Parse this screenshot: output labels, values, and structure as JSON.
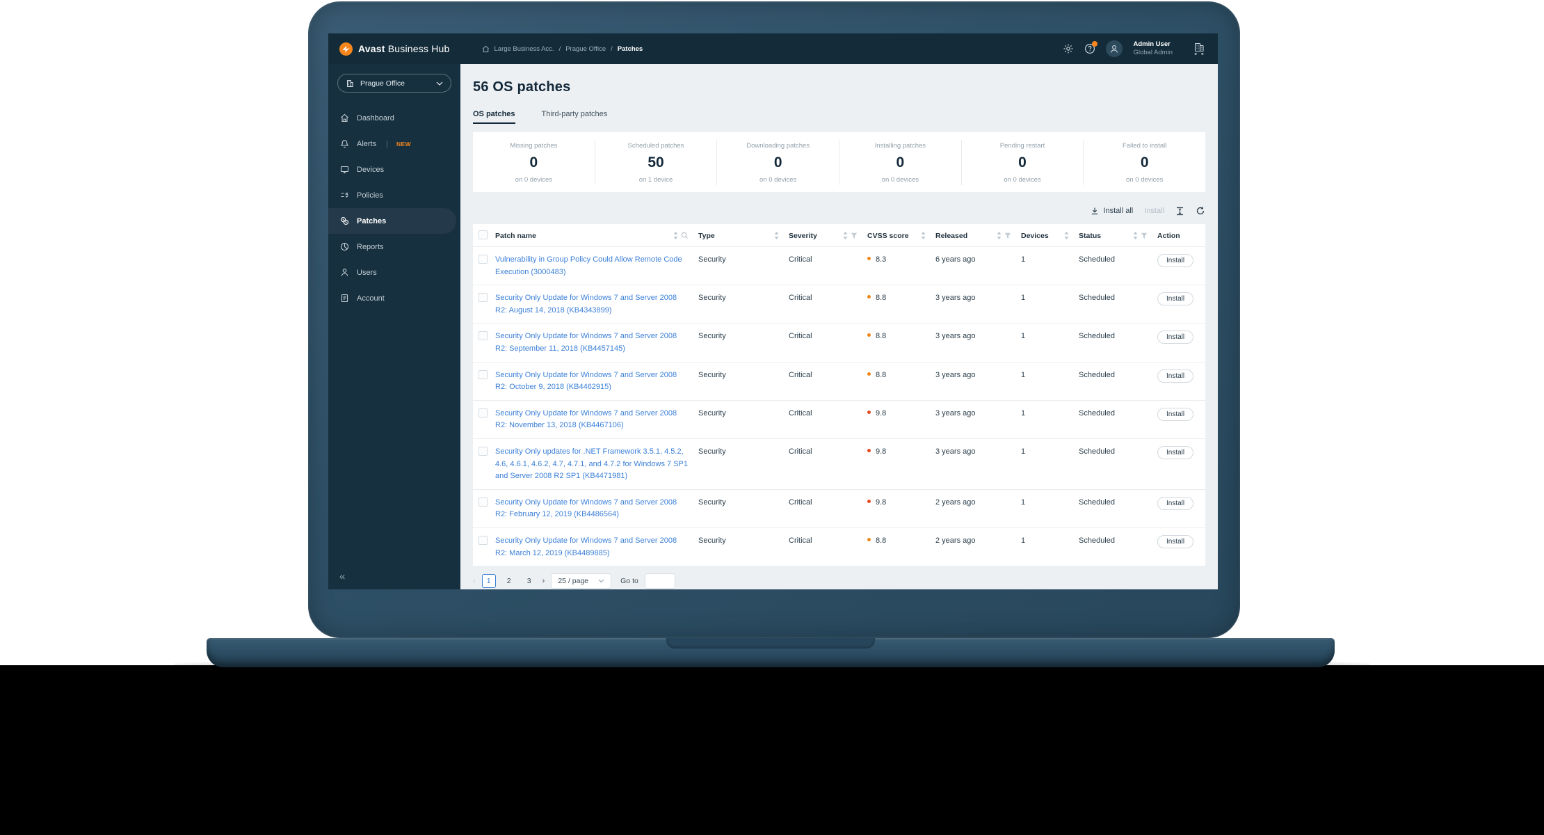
{
  "colors": {
    "accent_orange": "#f7861c",
    "link_blue": "#3c80d8",
    "cvss_high_dot": "#f08718",
    "cvss_critical_dot": "#e6491f",
    "topbar_navy": "#142c3a",
    "sidebar_navy": "#16303f",
    "active_nav_bg": "#24394a",
    "content_bg": "#edf0f3",
    "laptop_body": "#2e5066"
  },
  "topbar": {
    "brand_bold": "Avast",
    "brand_rest": " Business Hub",
    "breadcrumb": [
      "Large Business Acc.",
      "Prague Office",
      "Patches"
    ],
    "breadcrumb_separator": "/",
    "user_name": "Admin User",
    "user_role": "Global Admin"
  },
  "sidebar": {
    "site_selector": "Prague Office",
    "collapse_icon": "«",
    "items": [
      {
        "label": "Dashboard"
      },
      {
        "label": "Alerts",
        "badge": "NEW"
      },
      {
        "label": "Devices"
      },
      {
        "label": "Policies"
      },
      {
        "label": "Patches",
        "active": true
      },
      {
        "label": "Reports"
      },
      {
        "label": "Users"
      },
      {
        "label": "Account"
      }
    ]
  },
  "page": {
    "title": "56 OS patches",
    "tabs": [
      {
        "label": "OS patches",
        "active": true
      },
      {
        "label": "Third-party patches"
      }
    ]
  },
  "stats": [
    {
      "label": "Missing patches",
      "value": "0",
      "sub": "on 0 devices"
    },
    {
      "label": "Scheduled patches",
      "value": "50",
      "sub": "on 1 device"
    },
    {
      "label": "Downloading patches",
      "value": "0",
      "sub": "on 0 devices"
    },
    {
      "label": "Installing patches",
      "value": "0",
      "sub": "on 0 devices"
    },
    {
      "label": "Pending restart",
      "value": "0",
      "sub": "on 0 devices"
    },
    {
      "label": "Failed to install",
      "value": "0",
      "sub": "on 0 devices"
    }
  ],
  "toolbar": {
    "install_all": "Install all",
    "install": "Install"
  },
  "table": {
    "columns": [
      "Patch name",
      "Type",
      "Severity",
      "CVSS score",
      "Released",
      "Devices",
      "Status",
      "Action"
    ],
    "install_button": "Install",
    "rows": [
      {
        "name": "Vulnerability in Group Policy Could Allow Remote Code Execution (3000483)",
        "type": "Security",
        "severity": "Critical",
        "cvss": "8.3",
        "dot": "orange",
        "released": "6 years ago",
        "devices": "1",
        "status": "Scheduled"
      },
      {
        "name": "Security Only Update for Windows 7 and Server 2008 R2: August 14, 2018 (KB4343899)",
        "type": "Security",
        "severity": "Critical",
        "cvss": "8.8",
        "dot": "orange",
        "released": "3 years ago",
        "devices": "1",
        "status": "Scheduled"
      },
      {
        "name": "Security Only Update for Windows 7 and Server 2008 R2: September 11, 2018 (KB4457145)",
        "type": "Security",
        "severity": "Critical",
        "cvss": "8.8",
        "dot": "orange",
        "released": "3 years ago",
        "devices": "1",
        "status": "Scheduled"
      },
      {
        "name": "Security Only Update for Windows 7 and Server 2008 R2: October 9, 2018 (KB4462915)",
        "type": "Security",
        "severity": "Critical",
        "cvss": "8.8",
        "dot": "orange",
        "released": "3 years ago",
        "devices": "1",
        "status": "Scheduled"
      },
      {
        "name": "Security Only Update for Windows 7 and Server 2008 R2: November 13, 2018 (KB4467106)",
        "type": "Security",
        "severity": "Critical",
        "cvss": "9.8",
        "dot": "red",
        "released": "3 years ago",
        "devices": "1",
        "status": "Scheduled"
      },
      {
        "name": "Security Only updates for .NET Framework 3.5.1, 4.5.2, 4.6, 4.6.1, 4.6.2, 4.7, 4.7.1, and 4.7.2 for Windows 7 SP1 and Server 2008 R2 SP1 (KB4471981)",
        "type": "Security",
        "severity": "Critical",
        "cvss": "9.8",
        "dot": "red",
        "released": "3 years ago",
        "devices": "1",
        "status": "Scheduled"
      },
      {
        "name": "Security Only Update for Windows 7 and Server 2008 R2: February 12, 2019 (KB4486564)",
        "type": "Security",
        "severity": "Critical",
        "cvss": "9.8",
        "dot": "red",
        "released": "2 years ago",
        "devices": "1",
        "status": "Scheduled"
      },
      {
        "name": "Security Only Update for Windows 7 and Server 2008 R2: March 12, 2019 (KB4489885)",
        "type": "Security",
        "severity": "Critical",
        "cvss": "8.8",
        "dot": "orange",
        "released": "2 years ago",
        "devices": "1",
        "status": "Scheduled"
      }
    ]
  },
  "pagination": {
    "prev_icon": "‹",
    "next_icon": "›",
    "pages": [
      {
        "label": "1",
        "cls": "active"
      },
      {
        "label": "2"
      },
      {
        "label": "3"
      }
    ],
    "page_size": "25 / page",
    "goto_label": "Go to"
  }
}
